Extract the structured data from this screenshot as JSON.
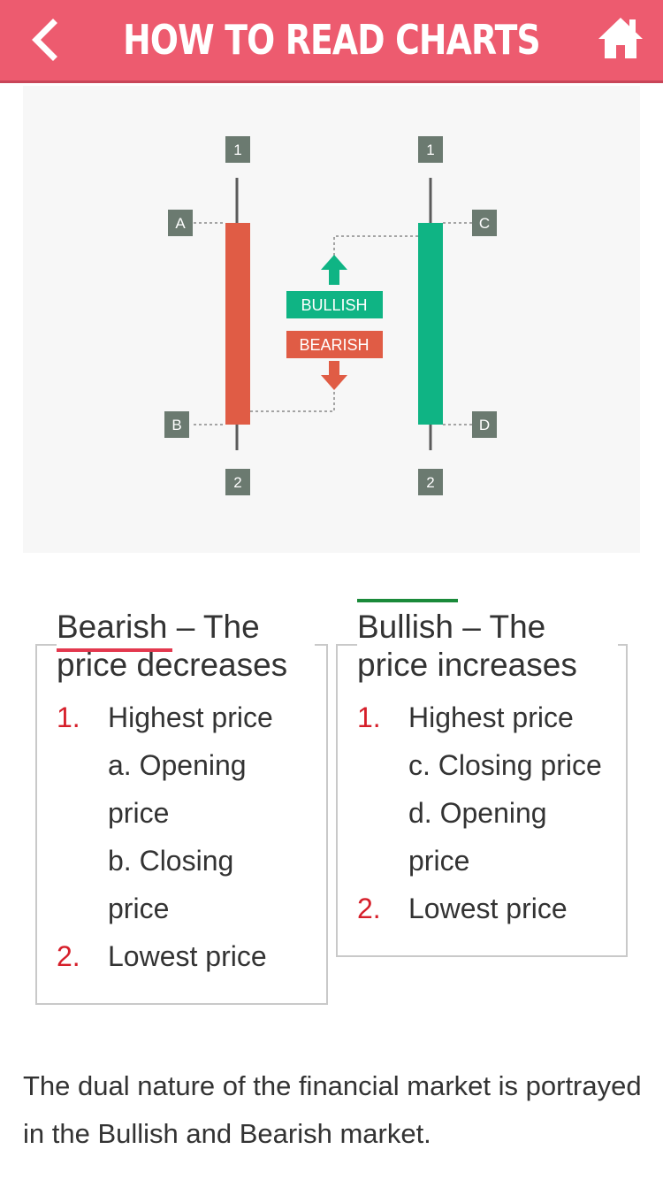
{
  "header": {
    "title": "HOW TO READ CHARTS",
    "back_icon": "chevron-left-icon",
    "home_icon": "home-icon",
    "background_color": "#ed5b6f"
  },
  "diagram": {
    "marker_top": "1",
    "marker_bottom": "2",
    "label_a": "A",
    "label_b": "B",
    "label_c": "C",
    "label_d": "D",
    "bullish_label": "BULLISH",
    "bearish_label": "BEARISH",
    "bearish_color": "#e05c45",
    "bullish_color": "#0fb484",
    "marker_color": "#6b7a70"
  },
  "bearish": {
    "heading": "Bearish – The price decreases",
    "items": [
      {
        "number": "1.",
        "text": "Highest price"
      },
      {
        "text": "a. Opening"
      },
      {
        "text": "price"
      },
      {
        "text": "b. Closing"
      },
      {
        "text": "price"
      },
      {
        "number": "2.",
        "text": "Lowest price"
      }
    ]
  },
  "bullish": {
    "heading": "Bullish – The price increases",
    "items": [
      {
        "number": "1.",
        "text": "Highest price"
      },
      {
        "text": "c. Closing price"
      },
      {
        "text": "d. Opening"
      },
      {
        "text": "price"
      },
      {
        "number": "2.",
        "text": "Lowest price"
      }
    ]
  },
  "footer": {
    "text": "The dual nature of the financial market is portrayed in the Bullish and Bearish market."
  }
}
